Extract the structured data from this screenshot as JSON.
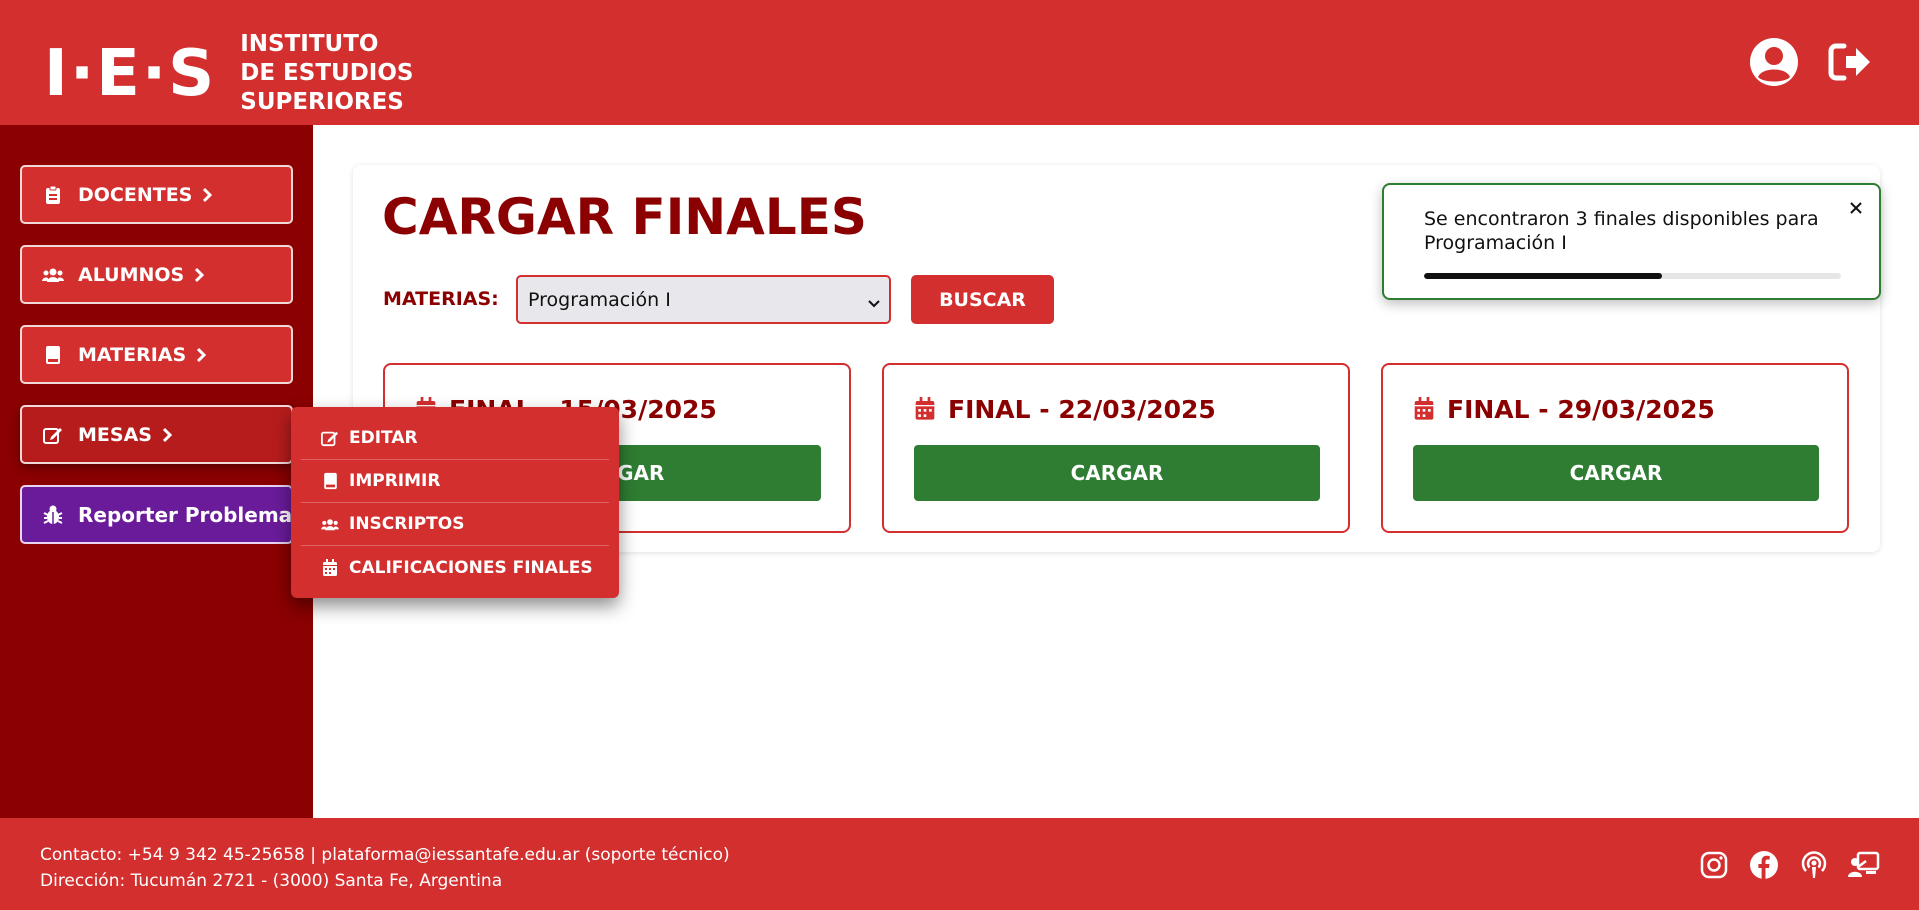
{
  "header": {
    "logo_mark": "I·E·S",
    "logo_lines": [
      "INSTITUTO",
      "DE ESTUDIOS",
      "SUPERIORES"
    ],
    "user_icon": "user-circle-icon",
    "logout_icon": "logout-icon"
  },
  "sidebar": {
    "items": [
      {
        "label": "DOCENTES",
        "icon": "clipboard-icon"
      },
      {
        "label": "ALUMNOS",
        "icon": "users-icon"
      },
      {
        "label": "MATERIAS",
        "icon": "book-icon"
      },
      {
        "label": "MESAS",
        "icon": "edit-icon"
      }
    ],
    "report_label": "Reporter Problema"
  },
  "dropdown": {
    "items": [
      {
        "label": "EDITAR",
        "icon": "edit-icon"
      },
      {
        "label": "IMPRIMIR",
        "icon": "book-icon"
      },
      {
        "label": "INSCRIPTOS",
        "icon": "users-icon"
      },
      {
        "label": "CALIFICACIONES FINALES",
        "icon": "calendar-icon"
      }
    ]
  },
  "main": {
    "title": "CARGAR FINALES",
    "filter_label": "MATERIAS:",
    "selected_subject": "Programación I",
    "search_label": "BUSCAR",
    "finals": [
      {
        "title": "FINAL - 15/03/2025",
        "button": "CARGAR"
      },
      {
        "title": "FINAL - 22/03/2025",
        "button": "CARGAR"
      },
      {
        "title": "FINAL - 29/03/2025",
        "button": "CARGAR"
      }
    ]
  },
  "toast": {
    "message": "Se encontraron 3 finales disponibles para Programación I",
    "progress": 0.57,
    "border_color": "#2e7d32"
  },
  "footer": {
    "contact": "Contacto: +54 9 342 45-25658 | plataforma@iessantafe.edu.ar (soporte técnico)",
    "address": "Dirección: Tucumán 2721 - (3000) Santa Fe, Argentina",
    "social_icons": [
      "instagram-icon",
      "facebook-icon",
      "podcast-icon",
      "classroom-icon"
    ]
  },
  "colors": {
    "brand_red": "#d32f2f",
    "dark_red": "#8b0000",
    "success_green": "#2e7d32",
    "report_purple": "#6a1b9a"
  }
}
